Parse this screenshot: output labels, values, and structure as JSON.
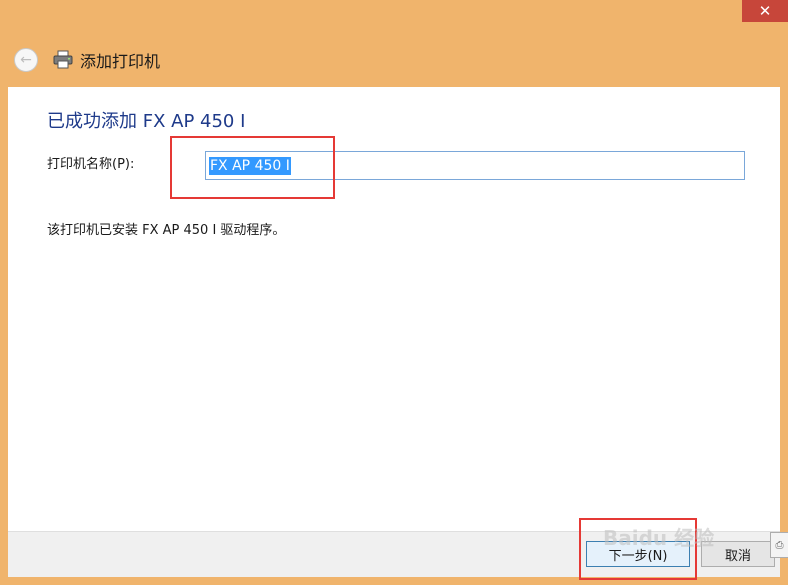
{
  "window": {
    "close_glyph": "✕",
    "title": "添加打印机",
    "back_icon": "back-arrow-icon",
    "printer_icon": "printer-icon"
  },
  "content": {
    "heading": "已成功添加 FX AP 450 I",
    "name_label": "打印机名称(P):",
    "name_value": "FX AP 450 I",
    "info": "该打印机已安装 FX AP 450 I 驱动程序。"
  },
  "buttons": {
    "next": "下一步(N)",
    "cancel": "取消"
  },
  "watermark": "Baidu 经验",
  "colors": {
    "frame": "#f0b46c",
    "heading": "#1e3a8a",
    "selection": "#3399ff",
    "highlight": "#e53935",
    "close": "#c7463a"
  }
}
